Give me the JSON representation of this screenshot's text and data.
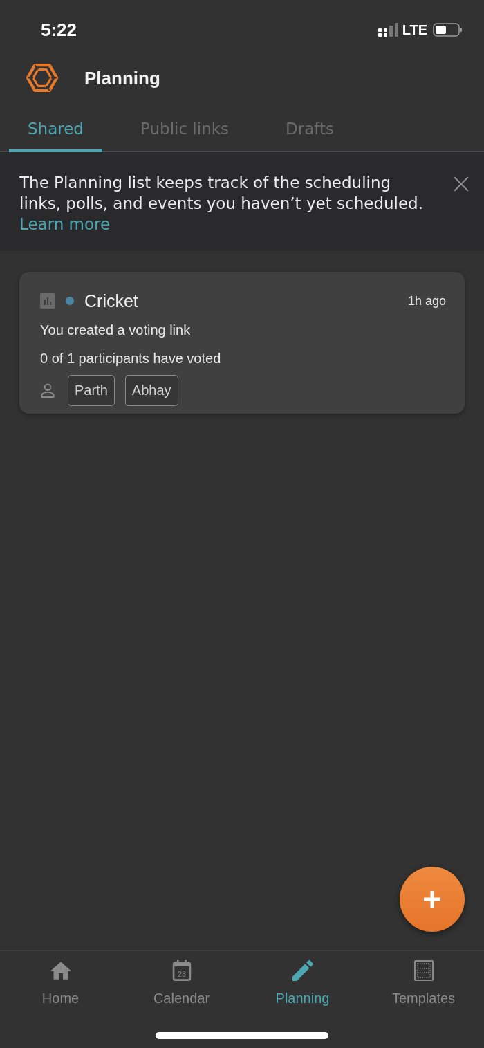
{
  "status_bar": {
    "time": "5:22",
    "network": "LTE"
  },
  "header": {
    "title": "Planning"
  },
  "tabs": [
    {
      "label": "Shared",
      "selected": true
    },
    {
      "label": "Public links",
      "selected": false
    },
    {
      "label": "Drafts",
      "selected": false
    }
  ],
  "banner": {
    "text": "The Planning list keeps track of the scheduling links, polls, and events you haven’t yet scheduled.",
    "link": "Learn more"
  },
  "items": [
    {
      "title": "Cricket",
      "color": "#4a86a3",
      "time": "1h ago",
      "description": "You created a voting link",
      "progress": "0 of 1 participants have voted",
      "participants": [
        "Parth",
        "Abhay"
      ]
    }
  ],
  "nav": [
    {
      "label": "Home",
      "selected": false
    },
    {
      "label": "Calendar",
      "date": "28",
      "selected": false
    },
    {
      "label": "Planning",
      "selected": true
    },
    {
      "label": "Templates",
      "selected": false
    }
  ]
}
